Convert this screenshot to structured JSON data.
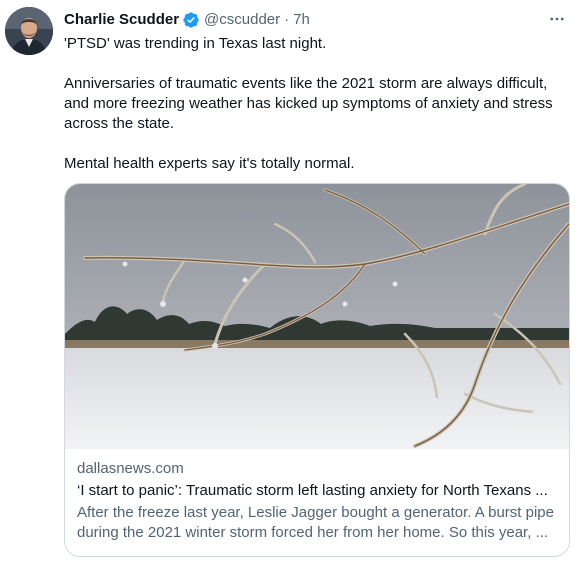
{
  "author": {
    "display_name": "Charlie Scudder",
    "handle": "@cscudder",
    "separator": "·",
    "time": "7h",
    "verified": true,
    "avatar_icon": "profile-photo"
  },
  "tweet": {
    "paragraphs": [
      "'PTSD' was trending in Texas last night.",
      "Anniversaries of traumatic events like the 2021 storm are always difficult, and more freezing weather has kicked up symptoms of anxiety and stress across the state.",
      "Mental health experts say it's totally normal."
    ]
  },
  "card": {
    "domain": "dallasnews.com",
    "title": "‘I start to panic’: Traumatic storm left lasting anxiety for North Texans ...",
    "description": "After the freeze last year, Leslie Jagger bought a generator. A burst pipe during the 2021 winter storm forced her from her home. So this year, ..."
  },
  "icons": {
    "verified": "verified-badge-icon",
    "more": "more-options-icon"
  },
  "colors": {
    "text_primary": "#0f1419",
    "text_secondary": "#536471",
    "verified_blue": "#1d9bf0",
    "border": "#cfd9de"
  }
}
